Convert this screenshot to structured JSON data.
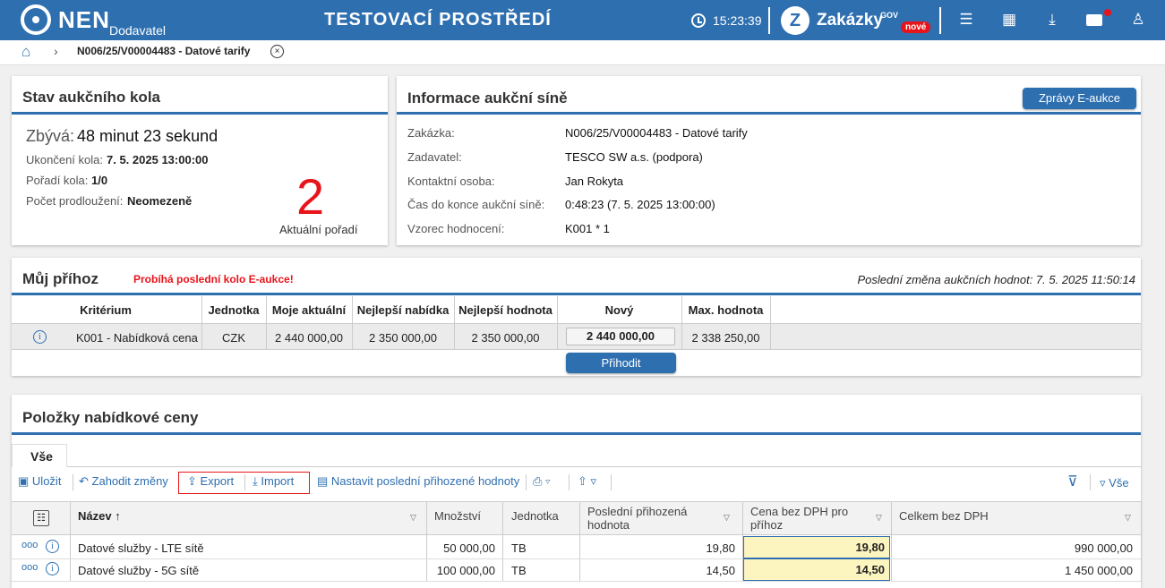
{
  "header": {
    "brand": "NEN",
    "brand_sub": "Dodavatel",
    "env_title": "TESTOVACÍ PROSTŘEDÍ",
    "time": "15:23:39",
    "zak_title": "Zakázky",
    "zak_gov": "GOV",
    "zak_badge": "nové",
    "icons": [
      "menu-icon",
      "calendar-icon",
      "download-icon",
      "mail-icon",
      "user-icon"
    ]
  },
  "breadcrumb": {
    "current": "N006/25/V00004483 - Datové tarify",
    "close": "×"
  },
  "auction_status": {
    "title": "Stav aukčního kola",
    "remaining_label": "Zbývá:",
    "remaining_value": "48 minut 23 sekund",
    "end_label": "Ukončení kola:",
    "end_value": "7. 5. 2025 13:00:00",
    "round_label": "Pořadí kola:",
    "round_value": "1/0",
    "ext_label": "Počet prodloužení:",
    "ext_value": "Neomezeně",
    "rank": "2",
    "rank_label": "Aktuální pořadí"
  },
  "auction_info": {
    "title": "Informace aukční síně",
    "button": "Zprávy E-aukce",
    "rows": [
      {
        "label": "Zakázka:",
        "value": "N006/25/V00004483 - Datové tarify"
      },
      {
        "label": "Zadavatel:",
        "value": "TESCO SW a.s. (podpora)"
      },
      {
        "label": "Kontaktní osoba:",
        "value": "Jan Rokyta"
      },
      {
        "label": "Čas do konce aukční síně:",
        "value": "0:48:23 (7. 5. 2025 13:00:00)"
      },
      {
        "label": "Vzorec hodnocení:",
        "value": "K001 * 1"
      }
    ]
  },
  "bid": {
    "title": "Můj příhoz",
    "warning": "Probíhá poslední kolo E-aukce!",
    "last_change": "Poslední změna aukčních hodnot: 7. 5. 2025 11:50:14",
    "headers": [
      "Kritérium",
      "Jednotka",
      "Moje aktuální",
      "Nejlepší nabídka",
      "Nejlepší hodnota",
      "Nový",
      "Max. hodnota"
    ],
    "row": {
      "criterion": "K001 - Nabídková cena",
      "unit": "CZK",
      "mine": "2 440 000,00",
      "best_offer": "2 350 000,00",
      "best_value": "2 350 000,00",
      "new": "2 440 000,00",
      "max": "2 338 250,00"
    },
    "button": "Přihodit"
  },
  "items": {
    "title": "Položky nabídkové ceny",
    "tab": "Vše",
    "toolbar": {
      "save": "Uložit",
      "discard": "Zahodit změny",
      "export": "Export",
      "import": "Import",
      "set_last": "Nastavit poslední přihozené hodnoty",
      "filter_all": "Vše"
    },
    "columns": [
      "Název",
      "Množství",
      "Jednotka",
      "Poslední přihozená hodnota",
      "Cena bez DPH pro příhoz",
      "Celkem bez DPH"
    ],
    "rows": [
      {
        "name": "Datové služby - LTE sítě",
        "qty": "50 000,00",
        "unit": "TB",
        "last": "19,80",
        "price": "19,80",
        "total": "990 000,00"
      },
      {
        "name": "Datové služby - 5G sítě",
        "qty": "100 000,00",
        "unit": "TB",
        "last": "14,50",
        "price": "14,50",
        "total": "1 450 000,00"
      }
    ]
  },
  "colors": {
    "brand": "#2e6fb0",
    "warning": "#e8141b",
    "highlight": "#fdf5c0"
  }
}
